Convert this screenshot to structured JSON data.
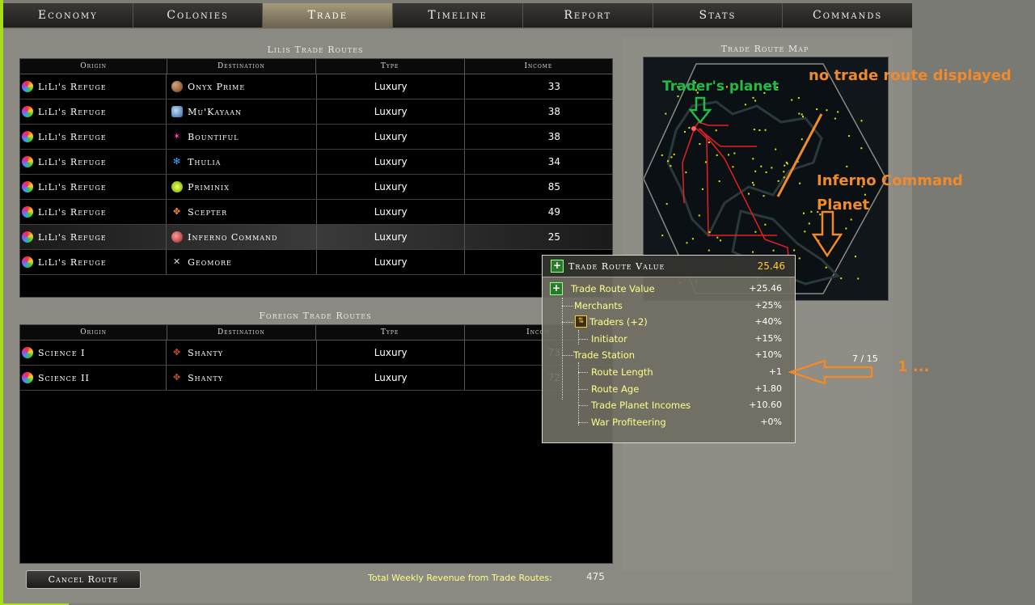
{
  "nav": {
    "tabs": [
      {
        "label": "Economy"
      },
      {
        "label": "Colonies"
      },
      {
        "label": "Trade"
      },
      {
        "label": "Timeline"
      },
      {
        "label": "Report"
      },
      {
        "label": "Stats"
      },
      {
        "label": "Commands"
      }
    ],
    "active": "Trade"
  },
  "own_routes": {
    "title": "Lilis Trade Routes",
    "columns": [
      "Origin",
      "Destination",
      "Type",
      "Income"
    ],
    "rows": [
      {
        "origin": "LiLi's Refuge",
        "destination": "Onyx Prime",
        "dest_icon": "onyx-prime-icon",
        "type": "Luxury",
        "income": "33"
      },
      {
        "origin": "LiLi's Refuge",
        "destination": "Mu'Kayaan",
        "dest_icon": "mukayaan-icon",
        "type": "Luxury",
        "income": "38"
      },
      {
        "origin": "LiLi's Refuge",
        "destination": "Bountiful",
        "dest_icon": "bountiful-icon",
        "type": "Luxury",
        "income": "38"
      },
      {
        "origin": "LiLi's Refuge",
        "destination": "Thulia",
        "dest_icon": "thulia-icon",
        "type": "Luxury",
        "income": "34"
      },
      {
        "origin": "LiLi's Refuge",
        "destination": "Priminix",
        "dest_icon": "priminix-icon",
        "type": "Luxury",
        "income": "85"
      },
      {
        "origin": "LiLi's Refuge",
        "destination": "Scepter",
        "dest_icon": "scepter-icon",
        "type": "Luxury",
        "income": "49"
      },
      {
        "origin": "LiLi's Refuge",
        "destination": "Inferno Command",
        "dest_icon": "inferno-command-icon",
        "type": "Luxury",
        "income": "25"
      },
      {
        "origin": "LiLi's Refuge",
        "destination": "Geomore",
        "dest_icon": "geomore-icon",
        "type": "Luxury",
        "income": ""
      }
    ]
  },
  "foreign_routes": {
    "title": "Foreign Trade Routes",
    "columns": [
      "Origin",
      "Destination",
      "Type",
      "Incom"
    ],
    "rows": [
      {
        "origin": "Science I",
        "destination": "Shanty",
        "type": "Luxury",
        "income": "73"
      },
      {
        "origin": "Science II",
        "destination": "Shanty",
        "type": "Luxury",
        "income": "72"
      }
    ]
  },
  "map": {
    "title": "Trade Route Map"
  },
  "right_panel": {
    "counter": "7 / 15"
  },
  "footer": {
    "cancel_label": "Cancel Route",
    "revenue_label": "Total Weekly Revenue from Trade Routes:",
    "revenue_value": "475"
  },
  "tooltip": {
    "header_title": "Trade Route Value",
    "header_value": "25.46",
    "lines": [
      {
        "label": "Trade Route Value",
        "value": "+25.46"
      },
      {
        "label": "Merchants",
        "value": "+25%"
      },
      {
        "label": "Traders (+2)",
        "value": "+40%"
      },
      {
        "label": "Initiator",
        "value": "+15%"
      },
      {
        "label": "Trade Station",
        "value": "+10%"
      },
      {
        "label": "Route Length",
        "value": "+1"
      },
      {
        "label": "Route Age",
        "value": "+1.80"
      },
      {
        "label": "Trade Planet Incomes",
        "value": "+10.60"
      },
      {
        "label": "War Profiteering",
        "value": "+0%"
      }
    ]
  },
  "annotations": {
    "traders_planet": "Trader's planet",
    "no_route": "no trade route displayed",
    "inferno_line1": "Inferno Command",
    "inferno_line2": "Planet",
    "one": "1 ..."
  },
  "colors": {
    "annotation_green": "#22bb44",
    "annotation_orange": "#f08a2a",
    "route_red": "#e52020",
    "star_yellow": "#e6e600",
    "tooltip_label": "#ffff88"
  }
}
